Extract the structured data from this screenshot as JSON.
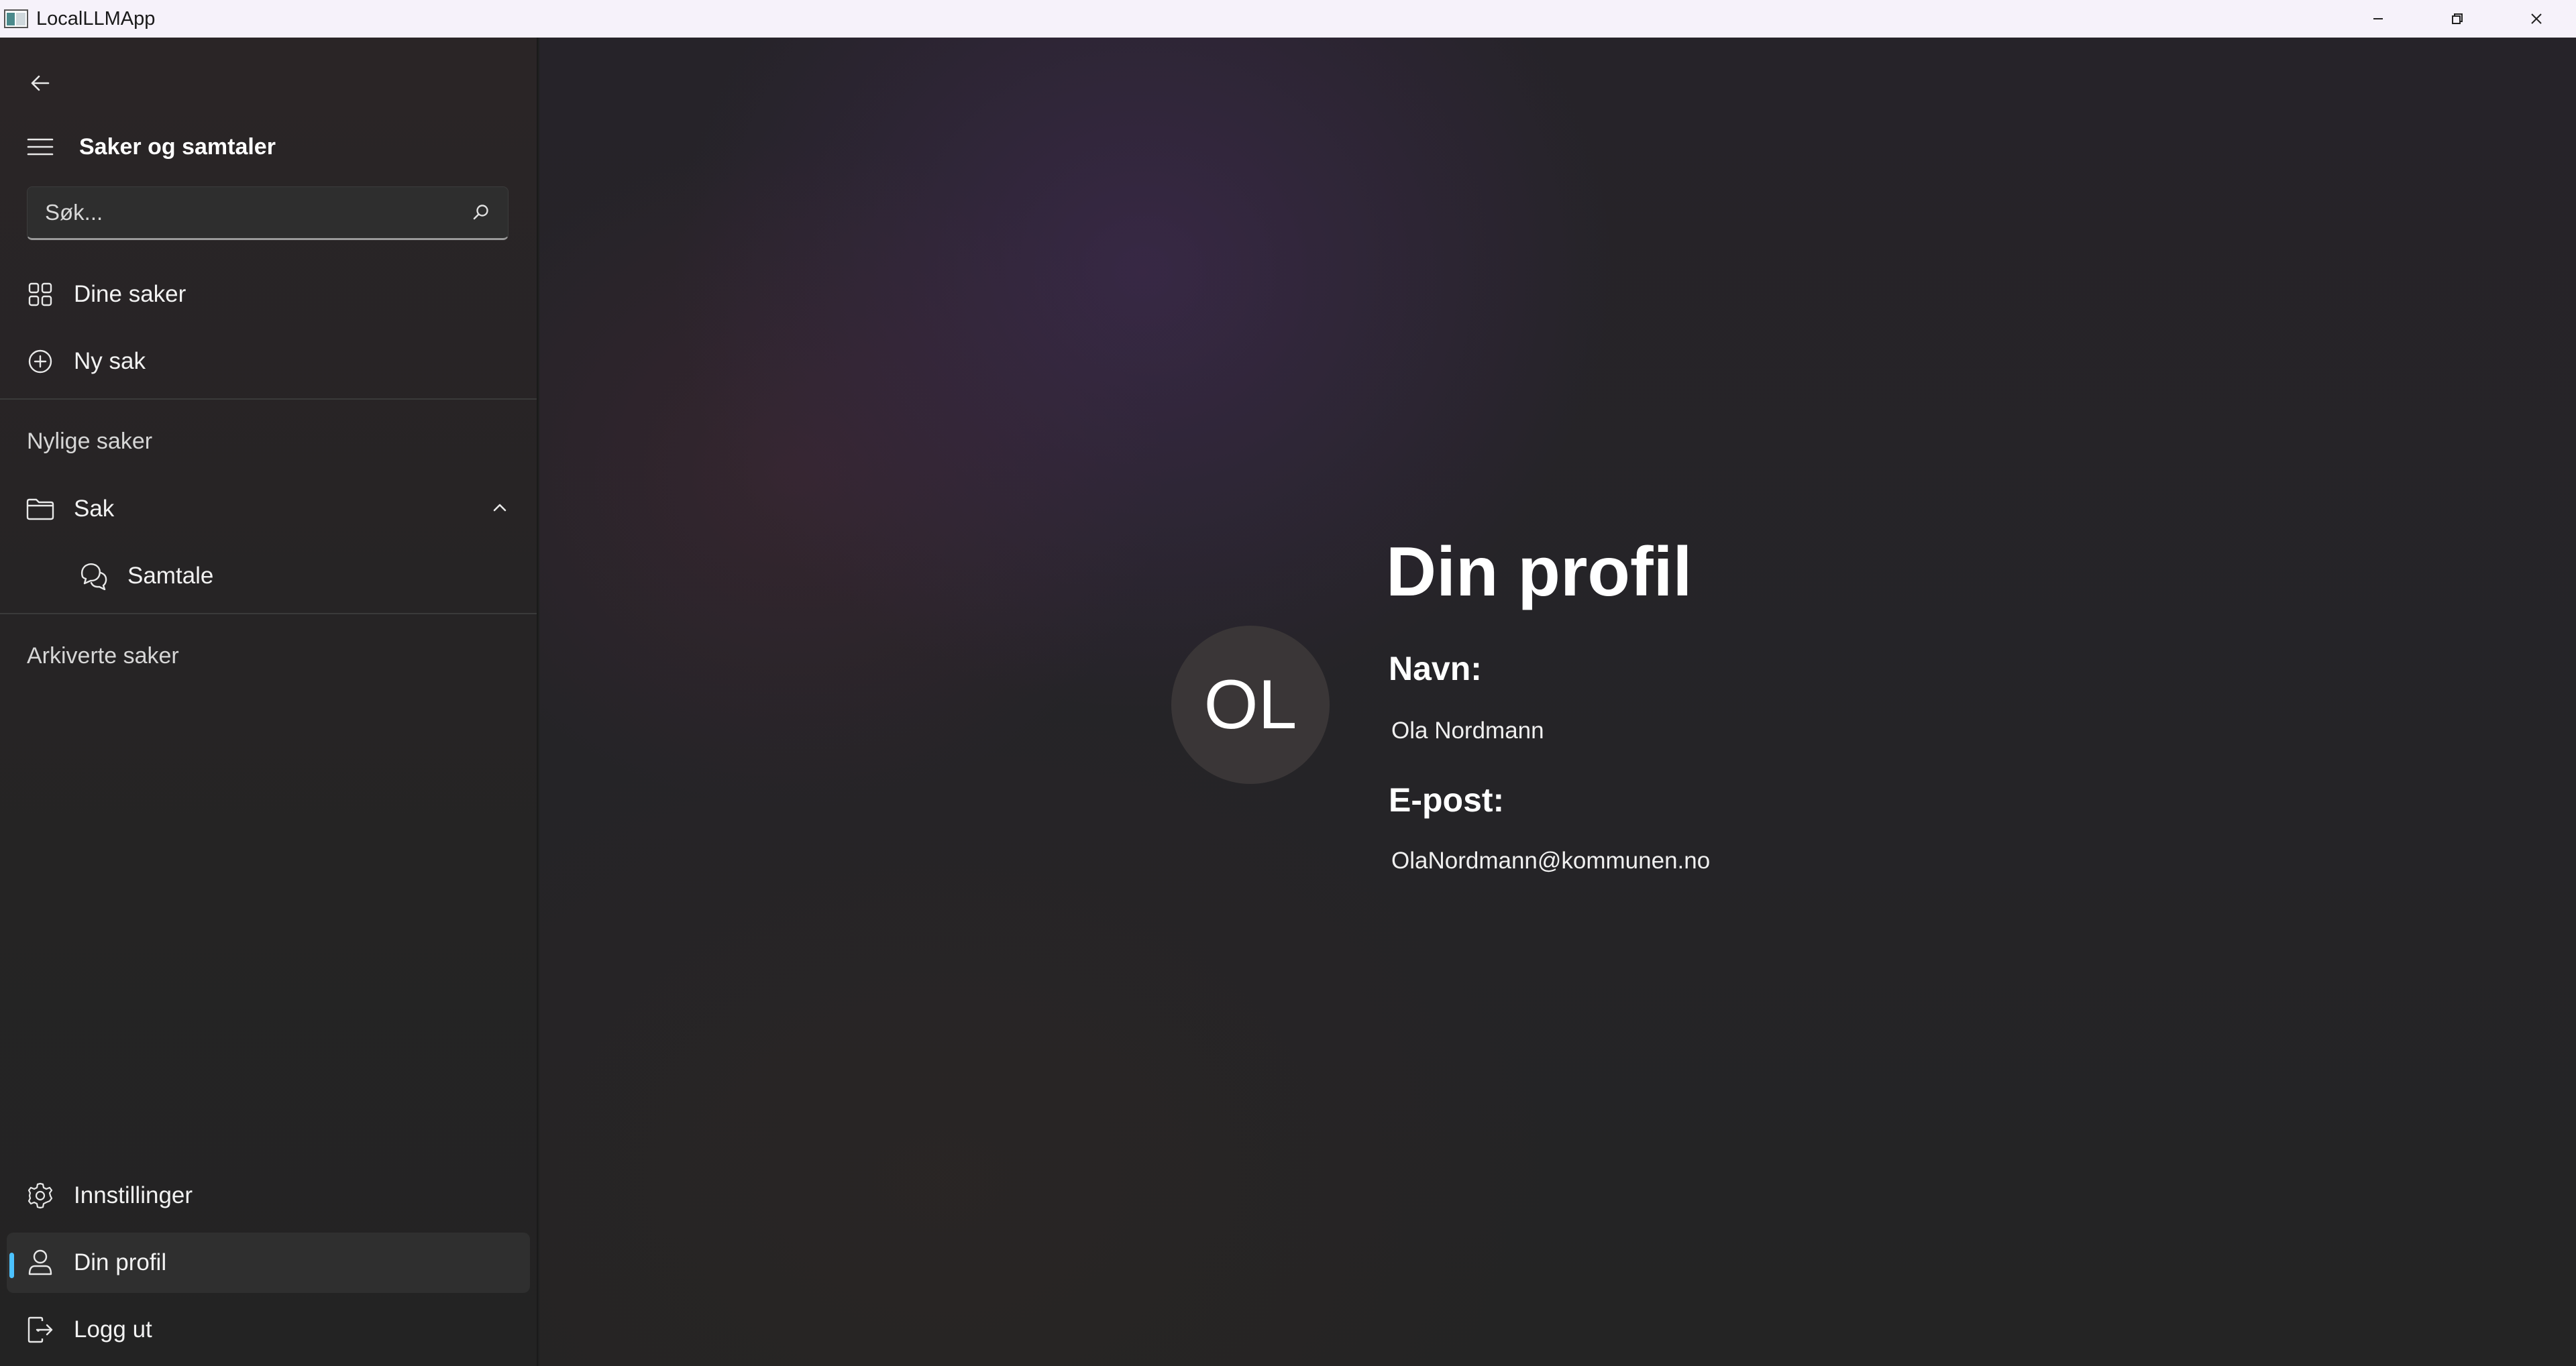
{
  "window": {
    "title": "LocalLLMApp"
  },
  "sidebar": {
    "title": "Saker og samtaler",
    "search": {
      "placeholder": "Søk...",
      "value": ""
    },
    "nav": [
      {
        "label": "Dine saker",
        "icon": "grid-icon"
      },
      {
        "label": "Ny sak",
        "icon": "add-circle-icon"
      }
    ],
    "recent_heading": "Nylige saker",
    "recent": [
      {
        "label": "Sak",
        "icon": "folder-icon",
        "expanded": true,
        "children": [
          {
            "label": "Samtale",
            "icon": "chat-icon"
          }
        ]
      }
    ],
    "archived_heading": "Arkiverte saker",
    "footer": [
      {
        "label": "Innstillinger",
        "icon": "gear-icon"
      },
      {
        "label": "Din profil",
        "icon": "person-icon",
        "active": true
      },
      {
        "label": "Logg ut",
        "icon": "sign-out-icon"
      }
    ]
  },
  "profile": {
    "title": "Din profil",
    "initials": "OL",
    "name_label": "Navn:",
    "name": "Ola Nordmann",
    "email_label": "E-post:",
    "email": "OlaNordmann@kommunen.no"
  },
  "colors": {
    "accent": "#4cc2ff",
    "titlebar": "#f6f2fa",
    "sidebar": "#262425",
    "main": "#252427"
  }
}
